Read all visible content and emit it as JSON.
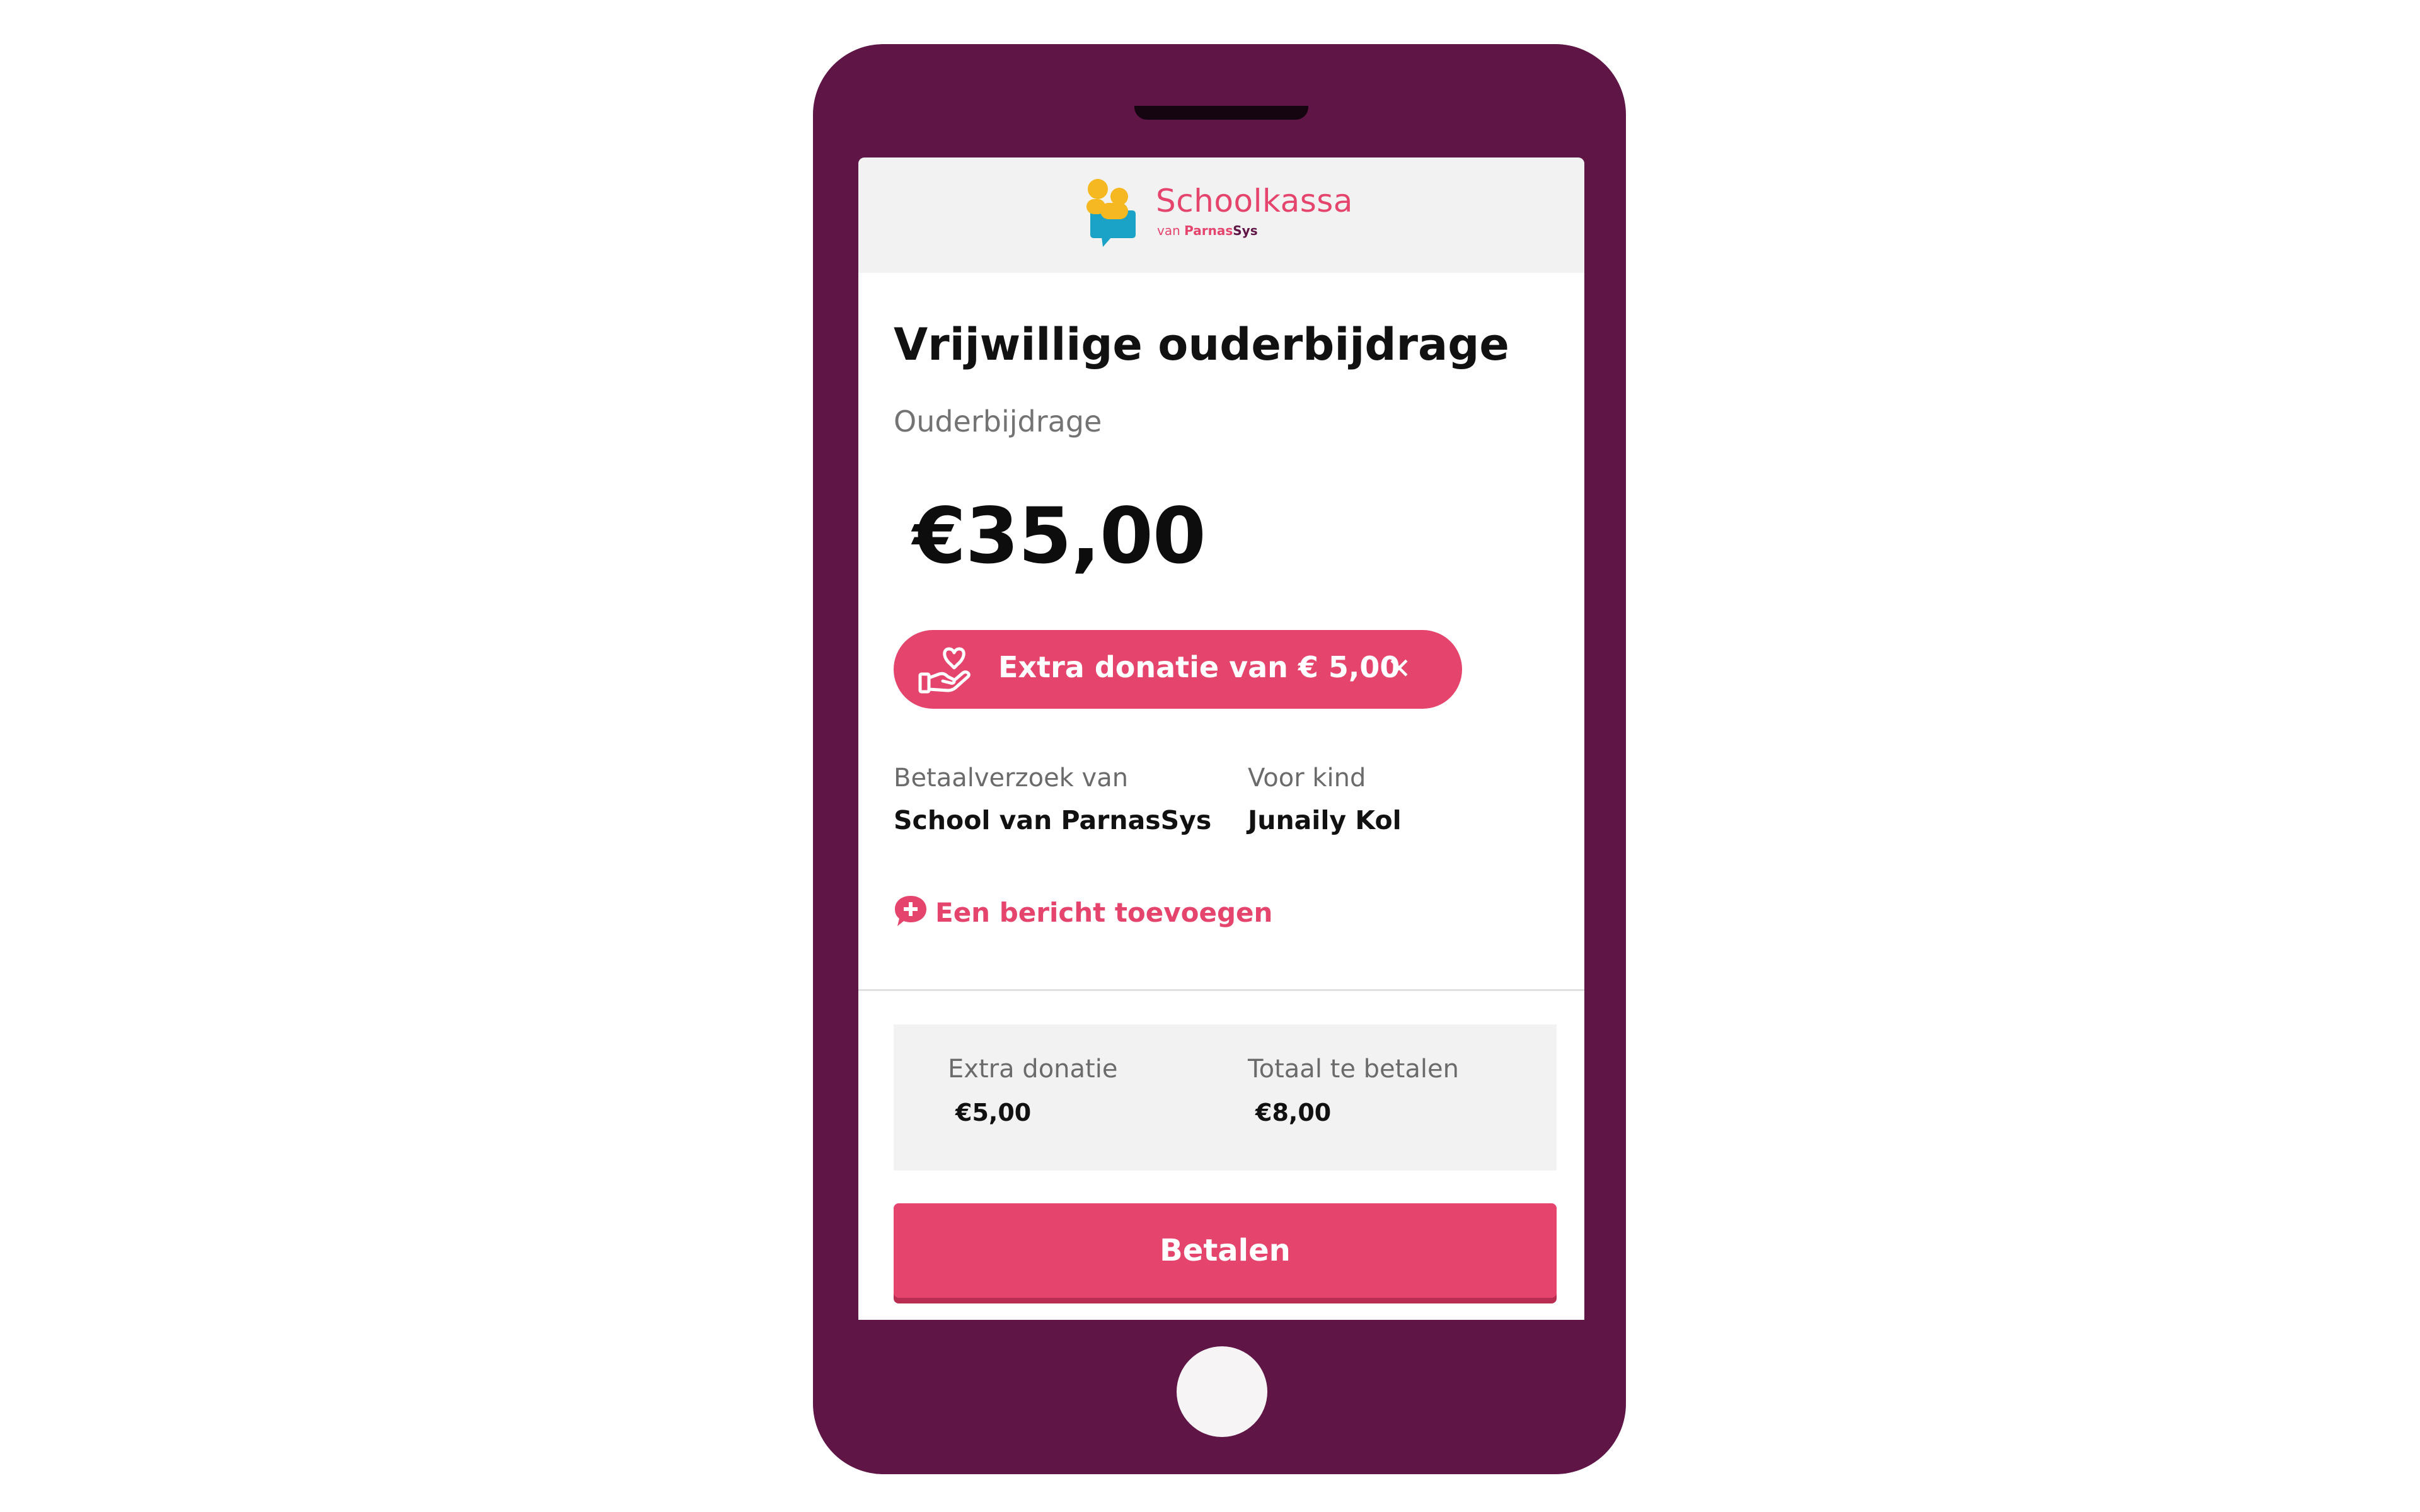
{
  "brand": {
    "name": "Schoolkassa",
    "sub_prefix": "van",
    "sub_company_a": "Parnas",
    "sub_company_b": "Sys"
  },
  "payment": {
    "title": "Vrijwillige ouderbijdrage",
    "subtitle": "Ouderbijdrage",
    "amount": "€35,00"
  },
  "donation_chip": {
    "label": "Extra donatie van € 5,00",
    "close": "✕",
    "icon": "heart-hand-icon"
  },
  "details": {
    "requester_label": "Betaalverzoek van",
    "requester_value": "School van ParnasSys",
    "child_label": "Voor kind",
    "child_value": "Junaily Kol"
  },
  "add_message": {
    "label": "Een bericht toevoegen",
    "icon": "chat-plus-icon"
  },
  "summary": {
    "donation_label": "Extra donatie",
    "donation_value": "€5,00",
    "total_label": "Totaal te betalen",
    "total_value": "€8,00"
  },
  "pay_button": {
    "label": "Betalen"
  },
  "colors": {
    "phone_frame": "#5f1546",
    "accent": "#e5446d",
    "header_bg": "#f2f2f2",
    "logo_yellow": "#f5b820",
    "logo_teal": "#1aa3c6"
  }
}
